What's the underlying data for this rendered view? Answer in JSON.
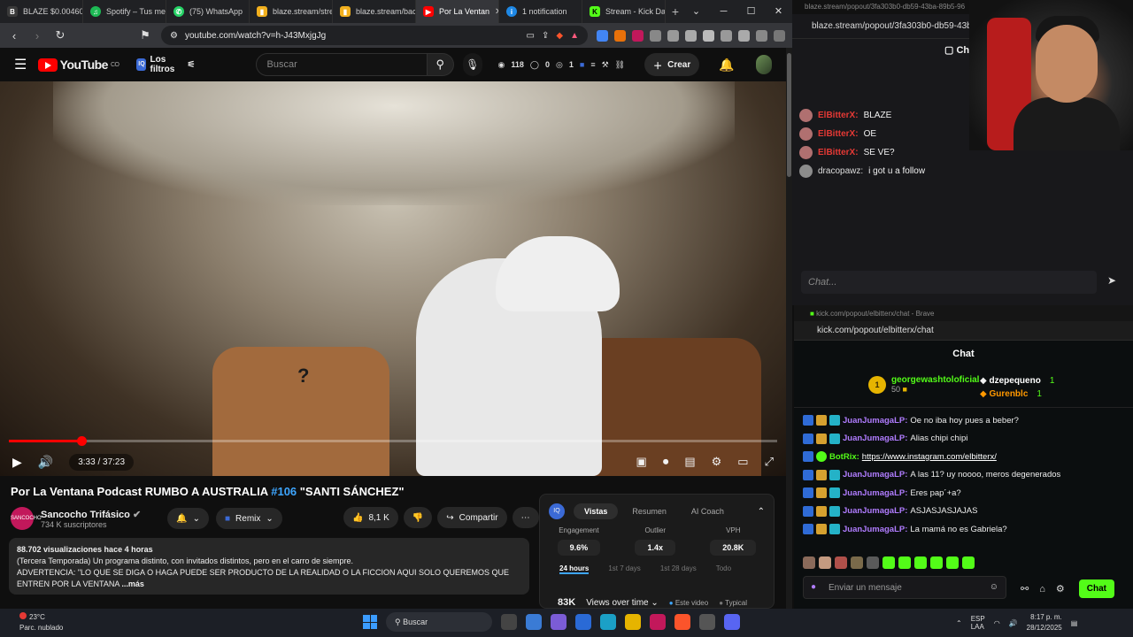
{
  "tabs": [
    {
      "label": "BLAZE $0.004607",
      "icon": "blaze-icon",
      "color": "#3a3a3a"
    },
    {
      "label": "Spotify – Tus me",
      "icon": "spotify-icon",
      "color": "#1db954"
    },
    {
      "label": "(75) WhatsApp",
      "icon": "whatsapp-icon",
      "color": "#25d366"
    },
    {
      "label": "blaze.stream/stre",
      "icon": "bookmark-icon",
      "color": "#f2b01e"
    },
    {
      "label": "blaze.stream/bac",
      "icon": "bookmark-icon",
      "color": "#f2b01e"
    },
    {
      "label": "Por La Ventan",
      "icon": "youtube-icon",
      "color": "#ff0000",
      "active": true
    },
    {
      "label": "1 notification",
      "icon": "globe-icon",
      "color": "#1e88e5"
    },
    {
      "label": "Stream - Kick Da",
      "icon": "kick-icon",
      "color": "#53fc18"
    }
  ],
  "browser": {
    "url": "youtube.com/watch?v=h-J43MxjgJg"
  },
  "yt": {
    "filters_label": "Los filtros",
    "search_placeholder": "Buscar",
    "stat1": "118",
    "stat2": "0",
    "stat3": "1",
    "create_label": "Crear"
  },
  "player": {
    "time": "3:33 / 37:23",
    "progress_fraction": 0.095,
    "overlay_mark": "?"
  },
  "video": {
    "title_prefix": "Por La Ventana Podcast RUMBO A AUSTRALIA ",
    "title_tag": "#106",
    "title_suffix": " \"SANTI SÁNCHEZ\"",
    "channel": "Sancocho Trifásico",
    "channel_logo_text": "SANCOCHO",
    "subscribers": "734 K suscriptores",
    "remix": "Remix",
    "likes": "8,1 K",
    "share": "Compartir",
    "desc_meta": "88.702 visualizaciones  hace 4 horas",
    "desc_line1": "(Tercera Temporada) Un programa distinto, con invitados distintos, pero en el carro de siempre.",
    "desc_line2": "ADVERTENCIA: \"LO QUE SE DIGA O HAGA PUEDE SER PRODUCTO DE LA REALIDAD O LA FICCION AQUI SOLO QUEREMOS QUE ENTREN POR LA VENTANA",
    "desc_more": "...más"
  },
  "analytics": {
    "badge": "IQ",
    "tabs": [
      "Vistas",
      "Resumen",
      "AI Coach"
    ],
    "metrics": [
      {
        "label": "Engagement",
        "value": "9.6%"
      },
      {
        "label": "Outlier",
        "value": "1.4x"
      },
      {
        "label": "VPH",
        "value": "20.8K"
      }
    ],
    "ranges": [
      "24 hours",
      "1st 7 days",
      "1st 28 days",
      "Todo"
    ],
    "views": "83K",
    "views_label": "Views over time",
    "legend1": "Este video",
    "legend2": "Typical"
  },
  "blaze": {
    "titlebar": "blaze.stream/popout/3fa303b0-db59-43ba-89b5-96",
    "url": "blaze.stream/popout/3fa303b0-db59-43ba",
    "header": "Chat",
    "messages": [
      {
        "user": "ElBitterX:",
        "text": "BLAZE"
      },
      {
        "user": "ElBitterX:",
        "text": "OE"
      },
      {
        "user": "ElBitterX:",
        "text": "SE VE?"
      },
      {
        "user": "dracopawz:",
        "text": "i got u a follow"
      }
    ],
    "input_placeholder": "Chat..."
  },
  "kick": {
    "titlebar": "kick.com/popout/elbitterx/chat - Brave",
    "url": "kick.com/popout/elbitterx/chat",
    "title": "Chat",
    "top_gifter": "georgewashtoloficial",
    "top_gifter_count": "50",
    "crown_label": "1",
    "gifter2": "dzepequeno",
    "gifter2_count": "1",
    "gifter3": "Gurenblc",
    "gifter3_count": "1",
    "messages": [
      {
        "user": "JuanJumagaLP:",
        "text": "Oe no iba hoy pues a beber?"
      },
      {
        "user": "JuanJumagaLP:",
        "text": "Alias chipi chipi"
      },
      {
        "user": "BotRix:",
        "text": "https://www.instagram.com/elbitterx/",
        "bot": true
      },
      {
        "user": "JuanJumagaLP:",
        "text": "A las 11? uy noooo, meros degenerados"
      },
      {
        "user": "JuanJumagaLP:",
        "text": "Eres pap´+a?"
      },
      {
        "user": "JuanJumagaLP:",
        "text": "ASJASJASJAJAS"
      },
      {
        "user": "JuanJumagaLP:",
        "text": "La mamá no es Gabriela?"
      }
    ],
    "input_placeholder": "Enviar un mensaje",
    "send_label": "Chat"
  },
  "taskbar": {
    "temp": "23°C",
    "weather": "Parc. nublado",
    "search": "Buscar",
    "lang1": "ESP",
    "lang2": "LAA",
    "time": "8:17 p. m.",
    "date": "28/12/2025"
  }
}
